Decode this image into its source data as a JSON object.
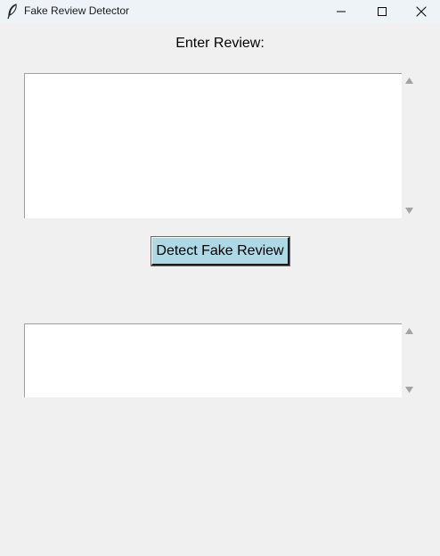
{
  "window": {
    "title": "Fake Review Detector",
    "controls": {
      "minimize_icon": "minimize-icon",
      "maximize_icon": "maximize-icon",
      "close_icon": "close-icon"
    },
    "app_icon": "feather-icon"
  },
  "main": {
    "prompt_label": "Enter Review:",
    "review_input_value": "",
    "detect_button_label": "Detect Fake Review",
    "result_value": ""
  },
  "colors": {
    "background": "#f0f0f0",
    "titlebar": "#eef3f8",
    "button_bg": "#add8e6",
    "textbox_bg": "#ffffff"
  }
}
